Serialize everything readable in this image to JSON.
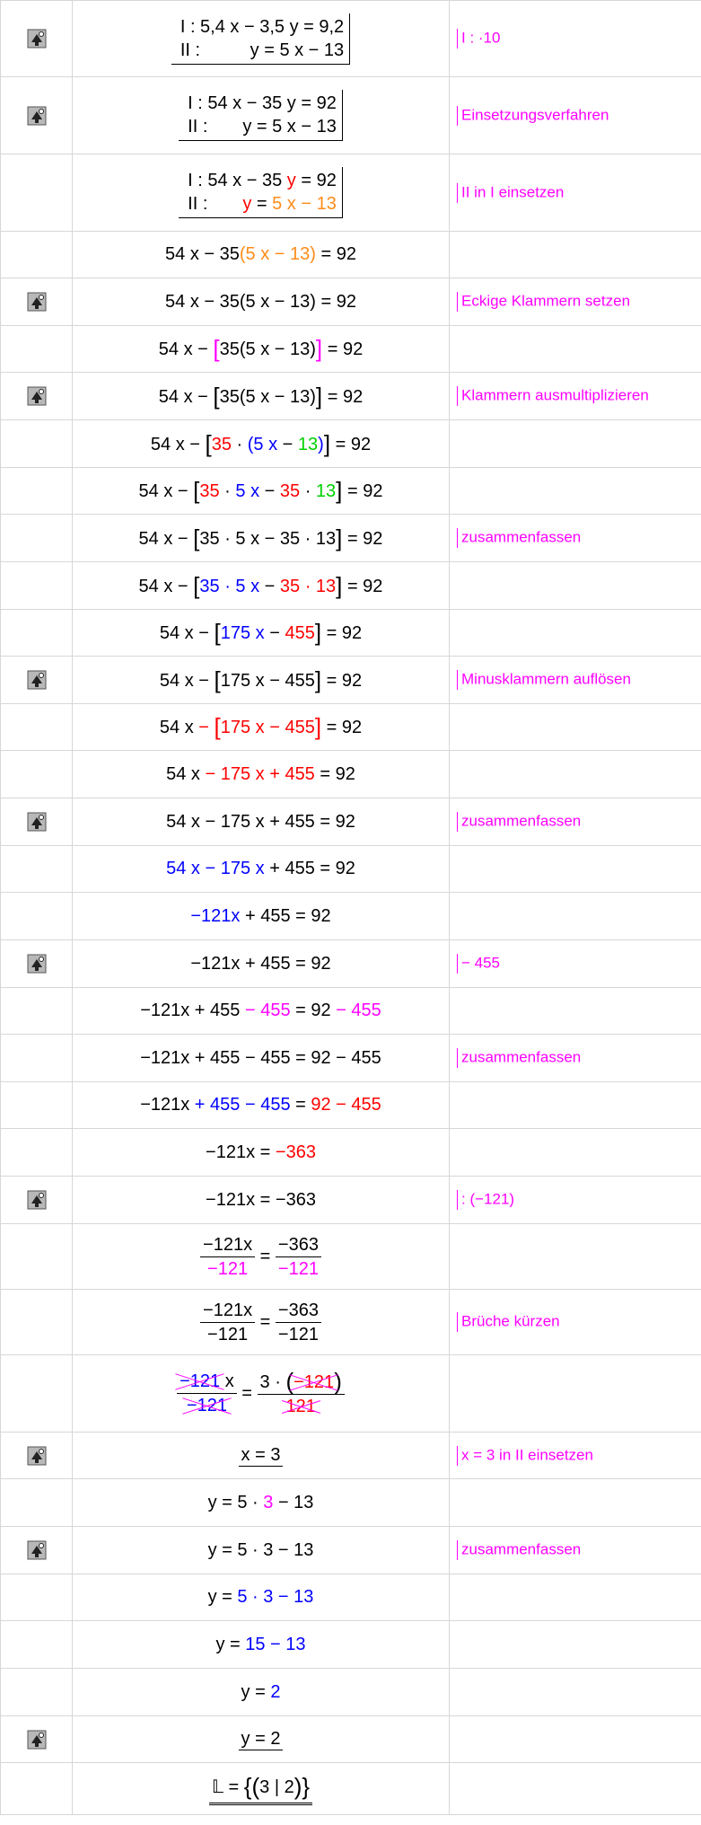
{
  "rows": [
    {
      "icon": true,
      "eq": [
        "I : 5,4 x − 3,5 y = 9,2",
        "II :            y = 5 x − 13"
      ],
      "note": "I : ·10"
    },
    {
      "icon": true,
      "eq": [
        "I : 54 x − 35 y = 92",
        "II :           y = 5 x − 13"
      ],
      "note": "Einsetzungsverfahren"
    },
    {
      "icon": false,
      "eq": [
        "I : 54 x − 35 y = 92",
        "II :           y = 5 x − 13"
      ],
      "note": "II in I einsetzen"
    },
    {
      "icon": false,
      "eq": "54 x − 35(5 x − 13) = 92",
      "note": ""
    },
    {
      "icon": true,
      "eq": "54 x − 35(5 x − 13) = 92",
      "note": "Eckige Klammern setzen"
    },
    {
      "icon": false,
      "eq": "54 x − [35(5 x − 13)] = 92",
      "note": ""
    },
    {
      "icon": true,
      "eq": "54 x − [35(5 x − 13)] = 92",
      "note": "Klammern ausmultiplizieren"
    },
    {
      "icon": false,
      "eq": "54 x − [35 · (5 x − 13)] = 92",
      "note": ""
    },
    {
      "icon": false,
      "eq": "54 x − [35 · 5 x − 35 · 13] = 92",
      "note": ""
    },
    {
      "icon": false,
      "eq": "54 x − [35 · 5 x − 35 · 13] = 92",
      "note": "zusammenfassen"
    },
    {
      "icon": false,
      "eq": "54 x − [35 · 5 x − 35 · 13] = 92",
      "note": ""
    },
    {
      "icon": false,
      "eq": "54 x − [175 x − 455] = 92",
      "note": ""
    },
    {
      "icon": true,
      "eq": "54 x − [175 x − 455] = 92",
      "note": "Minusklammern auflösen"
    },
    {
      "icon": false,
      "eq": "54 x − [175 x − 455] = 92",
      "note": ""
    },
    {
      "icon": false,
      "eq": "54 x − 175 x + 455 = 92",
      "note": ""
    },
    {
      "icon": true,
      "eq": "54 x − 175 x + 455 = 92",
      "note": "zusammenfassen"
    },
    {
      "icon": false,
      "eq": "54 x − 175 x + 455 = 92",
      "note": ""
    },
    {
      "icon": false,
      "eq": "−121x + 455 = 92",
      "note": ""
    },
    {
      "icon": true,
      "eq": "−121x + 455 = 92",
      "note": "− 455"
    },
    {
      "icon": false,
      "eq": "−121x + 455 − 455 = 92 − 455",
      "note": ""
    },
    {
      "icon": false,
      "eq": "−121x + 455 − 455 = 92 − 455",
      "note": "zusammenfassen"
    },
    {
      "icon": false,
      "eq": "−121x + 455 − 455 = 92 − 455",
      "note": ""
    },
    {
      "icon": false,
      "eq": "−121x = −363",
      "note": ""
    },
    {
      "icon": true,
      "eq": "−121x = −363",
      "note": ": (−121)"
    },
    {
      "icon": false,
      "eq": "−121x / −121 = −363 / −121",
      "note": ""
    },
    {
      "icon": false,
      "eq": "−121x / −121 = −363 / −121",
      "note": "Brüche kürzen"
    },
    {
      "icon": false,
      "eq": "−121 x / −121 = 3 · (−121) / 121",
      "note": ""
    },
    {
      "icon": true,
      "eq": "x = 3",
      "note": "x = 3 in II einsetzen"
    },
    {
      "icon": false,
      "eq": "y = 5 · 3 − 13",
      "note": ""
    },
    {
      "icon": true,
      "eq": "y = 5 · 3 − 13",
      "note": "zusammenfassen"
    },
    {
      "icon": false,
      "eq": "y = 5 · 3 − 13",
      "note": ""
    },
    {
      "icon": false,
      "eq": "y = 15 − 13",
      "note": ""
    },
    {
      "icon": false,
      "eq": "y = 2",
      "note": ""
    },
    {
      "icon": true,
      "eq": "y = 2",
      "note": ""
    },
    {
      "icon": false,
      "eq": "𝕃 = {(3 | 2)}",
      "note": ""
    }
  ],
  "icon_name": "step-hint-icon",
  "colors": {
    "note": "#ff00ff",
    "red": "#ff0000",
    "orange": "#ff8c1a",
    "blue": "#0000ff",
    "green": "#00d000",
    "border": "#d7d7d7"
  }
}
